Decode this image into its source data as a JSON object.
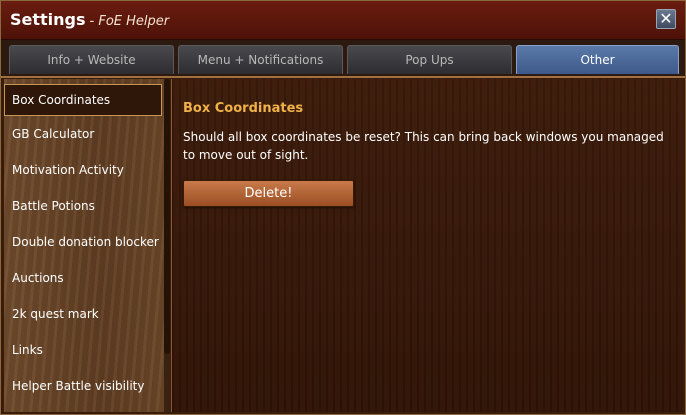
{
  "window": {
    "title": "Settings",
    "subtitle": "- FoE Helper",
    "close_glyph": "✕"
  },
  "tabs": [
    {
      "label": "Info + Website",
      "active": false
    },
    {
      "label": "Menu + Notifications",
      "active": false
    },
    {
      "label": "Pop Ups",
      "active": false
    },
    {
      "label": "Other",
      "active": true
    }
  ],
  "sidebar": {
    "items": [
      {
        "label": "Box Coordinates",
        "active": true
      },
      {
        "label": "GB Calculator",
        "active": false
      },
      {
        "label": "Motivation Activity",
        "active": false
      },
      {
        "label": "Battle Potions",
        "active": false
      },
      {
        "label": "Double donation blocker",
        "active": false
      },
      {
        "label": "Auctions",
        "active": false
      },
      {
        "label": "2k quest mark",
        "active": false
      },
      {
        "label": "Links",
        "active": false
      },
      {
        "label": "Helper Battle visibility",
        "active": false
      }
    ]
  },
  "content": {
    "title": "Box Coordinates",
    "description": "Should all box coordinates be reset? This can bring back windows you managed to move out of sight.",
    "button_label": "Delete!"
  },
  "colors": {
    "title_bar": "#5a1608",
    "active_tab": "#4a68a0",
    "accent_heading": "#f0b248",
    "button": "#b0643a"
  }
}
